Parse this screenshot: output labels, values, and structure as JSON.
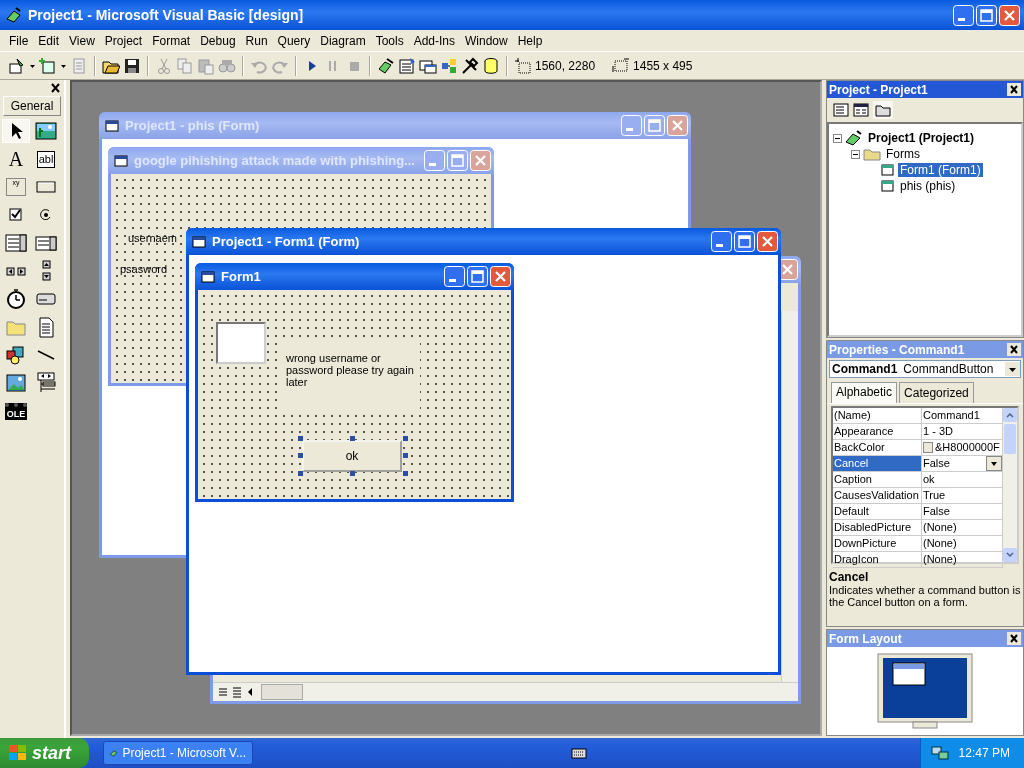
{
  "window": {
    "title": "Project1 - Microsoft Visual Basic [design]"
  },
  "menu": [
    "File",
    "Edit",
    "View",
    "Project",
    "Format",
    "Debug",
    "Run",
    "Query",
    "Diagram",
    "Tools",
    "Add-Ins",
    "Window",
    "Help"
  ],
  "toolbar": {
    "position": "1560, 2280",
    "size": "1455 x 495"
  },
  "toolbox": {
    "tab": "General",
    "tools": [
      {
        "kind": "pointer",
        "selected": true
      },
      {
        "kind": "picture",
        "selected": false
      },
      {
        "kind": "label",
        "selected": false,
        "glyph": "A"
      },
      {
        "kind": "textbox",
        "selected": false,
        "glyph": "abl"
      },
      {
        "kind": "frame",
        "selected": false,
        "glyph": "xy"
      },
      {
        "kind": "command",
        "selected": false
      },
      {
        "kind": "checkbox",
        "selected": false
      },
      {
        "kind": "option",
        "selected": false
      },
      {
        "kind": "combo",
        "selected": false
      },
      {
        "kind": "list",
        "selected": false
      },
      {
        "kind": "hscroll",
        "selected": false
      },
      {
        "kind": "vscroll",
        "selected": false
      },
      {
        "kind": "timer",
        "selected": false
      },
      {
        "kind": "drive",
        "selected": false
      },
      {
        "kind": "folder",
        "selected": false
      },
      {
        "kind": "file",
        "selected": false
      },
      {
        "kind": "shape",
        "selected": false
      },
      {
        "kind": "line",
        "selected": false
      },
      {
        "kind": "image",
        "selected": false
      },
      {
        "kind": "data",
        "selected": false
      },
      {
        "kind": "ole",
        "selected": false,
        "glyph": "OLE"
      }
    ]
  },
  "designers": [
    {
      "kind": "form",
      "title": "Project1 - phis (Form)",
      "active": false,
      "form": {
        "title": "google pihishing attack made with phishing...",
        "active": false,
        "labels": [
          "usernaem",
          "psasword"
        ]
      }
    },
    {
      "kind": "code",
      "active": false
    },
    {
      "kind": "form",
      "title": "Project1 - Form1 (Form)",
      "active": true,
      "form": {
        "title": "Form1",
        "active": true,
        "message": "wrong username or password please try again later",
        "button": "ok"
      }
    }
  ],
  "project": {
    "title": "Project - Project1",
    "active": true,
    "tree": [
      {
        "label": "Project1 (Project1)",
        "kind": "project",
        "expanded": true,
        "selected": false,
        "children": [
          {
            "label": "Forms",
            "kind": "folder",
            "expanded": true,
            "selected": false,
            "children": [
              {
                "label": "Form1 (Form1)",
                "kind": "form",
                "selected": true
              },
              {
                "label": "phis (phis)",
                "kind": "form",
                "selected": false
              }
            ]
          }
        ]
      }
    ]
  },
  "properties": {
    "title": "Properties - Command1",
    "active": false,
    "object": "Command1",
    "object_type": "CommandButton",
    "tabs": [
      {
        "label": "Alphabetic",
        "selected": true
      },
      {
        "label": "Categorized",
        "selected": false
      }
    ],
    "rows": [
      {
        "name": "(Name)",
        "value": "Command1",
        "kind": "text",
        "selected": false
      },
      {
        "name": "Appearance",
        "value": "1 - 3D",
        "kind": "text",
        "selected": false
      },
      {
        "name": "BackColor",
        "value": "&H8000000F",
        "kind": "color",
        "selected": false
      },
      {
        "name": "Cancel",
        "value": "False",
        "kind": "text",
        "selected": true
      },
      {
        "name": "Caption",
        "value": "ok",
        "kind": "text",
        "selected": false
      },
      {
        "name": "CausesValidation",
        "value": "True",
        "kind": "text",
        "selected": false
      },
      {
        "name": "Default",
        "value": "False",
        "kind": "text",
        "selected": false
      },
      {
        "name": "DisabledPicture",
        "value": "(None)",
        "kind": "text",
        "selected": false
      },
      {
        "name": "DownPicture",
        "value": "(None)",
        "kind": "text",
        "selected": false
      },
      {
        "name": "DragIcon",
        "value": "(None)",
        "kind": "text",
        "selected": false
      }
    ],
    "description": {
      "title": "Cancel",
      "text": "Indicates whether a command button is the Cancel button on a form."
    }
  },
  "form_layout": {
    "title": "Form Layout",
    "active": false
  },
  "taskbar": {
    "start": "start",
    "tasks": [
      {
        "label": "Project1 - Microsoft V...",
        "selected": false
      }
    ],
    "clock": "12:47 PM"
  }
}
